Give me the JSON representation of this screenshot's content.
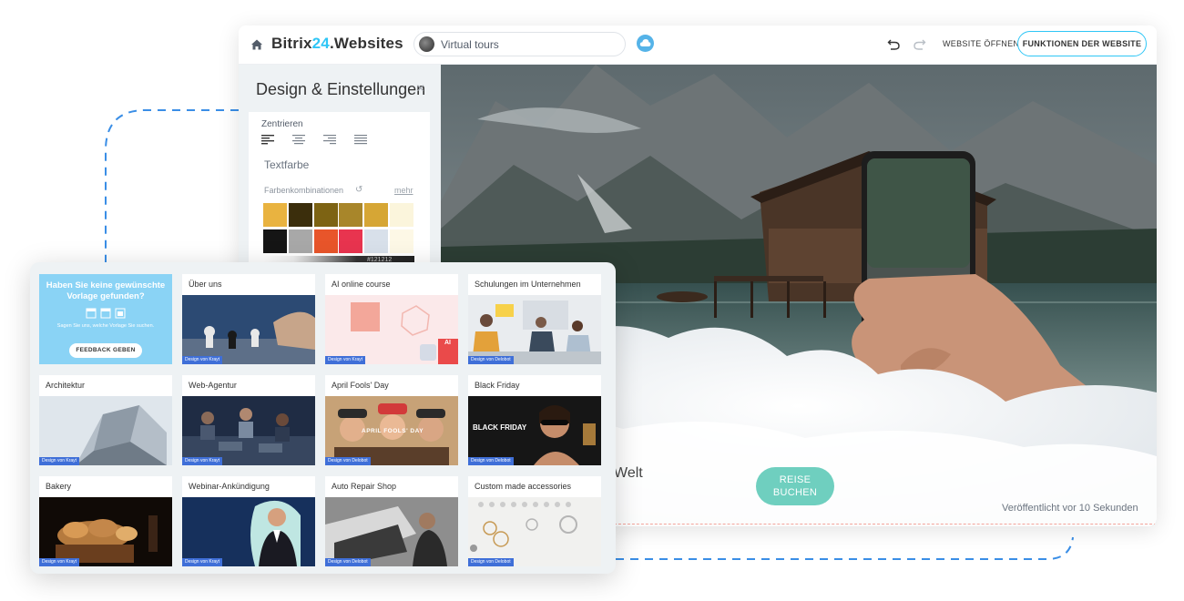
{
  "header": {
    "brand_part1": "Bitrix",
    "brand_part2": "24",
    "brand_part3": ".Websites",
    "site_select_value": "Virtual tours",
    "open_website_label": "WEBSITE ÖFFNEN",
    "website_features_label": "FUNKTIONEN DER WEBSITE"
  },
  "settings": {
    "title": "Design & Einstellungen",
    "close_glyph": "×",
    "align_label": "Zentrieren",
    "text_color_label": "Textfarbe",
    "color_combos_label": "Farbenkombinationen",
    "more_label": "mehr",
    "hex_value": "#121212",
    "swatches": [
      "#e9b340",
      "#3b2e0c",
      "#7d6313",
      "#a8862a",
      "#d6a635",
      "#fbf5dc",
      "#151515",
      "#a8a8a8",
      "#e8552a",
      "#e8344f",
      "#d8e0ea",
      "#fdf8e6"
    ]
  },
  "hero": {
    "text_fragment": "Welt",
    "book_button_line1": "REISE",
    "book_button_line2": "BUCHEN",
    "published_text": "Veröffentlicht vor 10 Sekunden"
  },
  "gallery": {
    "feedback": {
      "title": "Haben Sie keine gewünschte Vorlage gefunden?",
      "subtitle": "Sagen Sie uns, welche Vorlage Sie suchen.",
      "button": "FEEDBACK GEBEN"
    },
    "templates": [
      {
        "title": "Über uns",
        "badge": "Design von Krayt"
      },
      {
        "title": "AI online course",
        "badge": "Design von Krayt"
      },
      {
        "title": "Schulungen im Unternehmen",
        "badge": "Design von Delobot"
      },
      {
        "title": "Architektur",
        "badge": "Design von Krayt"
      },
      {
        "title": "Web-Agentur",
        "badge": "Design von Krayt"
      },
      {
        "title": "April Fools' Day",
        "badge": "Design von Delobot"
      },
      {
        "title": "Black Friday",
        "badge": "Design von Delobot"
      },
      {
        "title": "Bakery",
        "badge": "Design von Krayt"
      },
      {
        "title": "Webinar-Ankündigung",
        "badge": "Design von Krayt"
      },
      {
        "title": "Auto Repair Shop",
        "badge": "Design von Delobot"
      },
      {
        "title": "Custom made accessories",
        "badge": "Design von Delobot"
      }
    ],
    "image_texts": {
      "april_fools_banner": "APRIL FOOLS' DAY",
      "black_friday_banner": "BLACK FRIDAY",
      "ai_badge": "AI"
    }
  }
}
